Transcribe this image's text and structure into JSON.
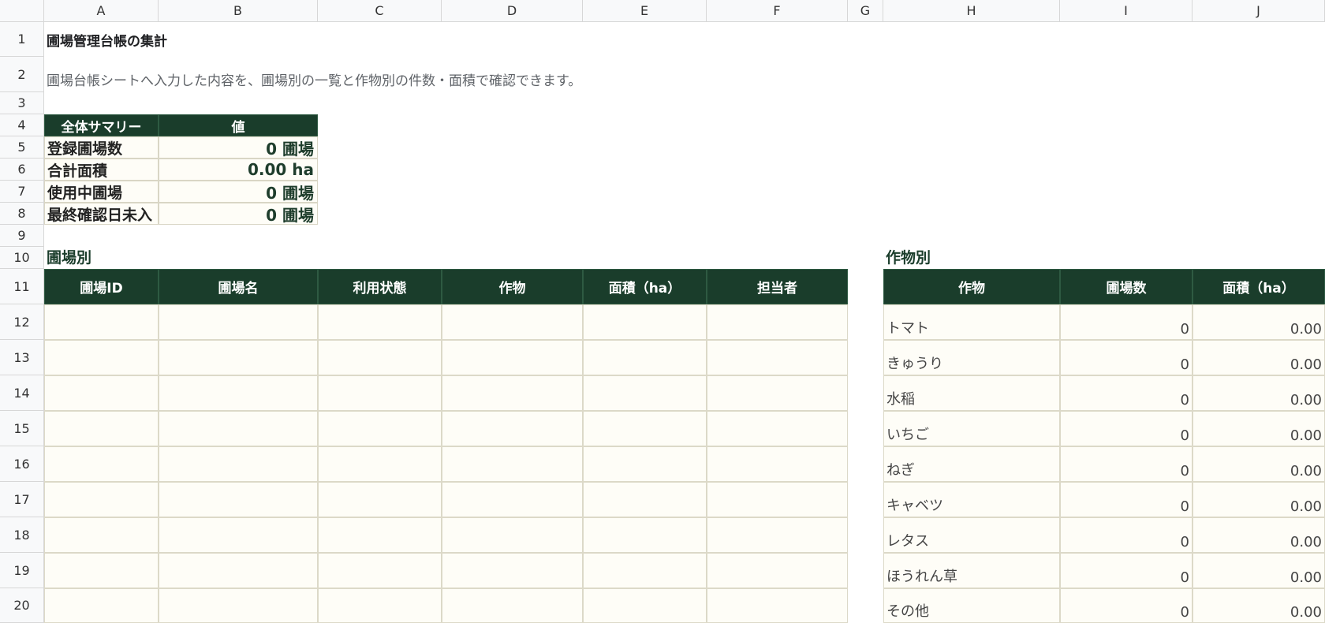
{
  "columns": [
    "A",
    "B",
    "C",
    "D",
    "E",
    "F",
    "G",
    "H",
    "I",
    "J"
  ],
  "rows": [
    "1",
    "2",
    "3",
    "4",
    "5",
    "6",
    "7",
    "8",
    "9",
    "10",
    "11",
    "12",
    "13",
    "14",
    "15",
    "16",
    "17",
    "18",
    "19",
    "20"
  ],
  "title": "圃場管理台帳の集計",
  "subtitle": "圃場台帳シートへ入力した内容を、圃場別の一覧と作物別の件数・面積で確認できます。",
  "summary": {
    "header_label": "全体サマリー",
    "header_value": "値",
    "items": [
      {
        "label": "登録圃場数",
        "value": "0 圃場"
      },
      {
        "label": "合計面積",
        "value": "0.00 ha"
      },
      {
        "label": "使用中圃場",
        "value": "0 圃場"
      },
      {
        "label": "最終確認日未入",
        "value": "0 圃場"
      }
    ]
  },
  "field_section": {
    "title": "圃場別",
    "headers": [
      "圃場ID",
      "圃場名",
      "利用状態",
      "作物",
      "面積（ha）",
      "担当者"
    ]
  },
  "crop_section": {
    "title": "作物別",
    "headers": [
      "作物",
      "圃場数",
      "面積（ha）"
    ],
    "rows": [
      {
        "crop": "トマト",
        "count": "0",
        "area": "0.00"
      },
      {
        "crop": "きゅうり",
        "count": "0",
        "area": "0.00"
      },
      {
        "crop": "水稲",
        "count": "0",
        "area": "0.00"
      },
      {
        "crop": "いちご",
        "count": "0",
        "area": "0.00"
      },
      {
        "crop": "ねぎ",
        "count": "0",
        "area": "0.00"
      },
      {
        "crop": "キャベツ",
        "count": "0",
        "area": "0.00"
      },
      {
        "crop": "レタス",
        "count": "0",
        "area": "0.00"
      },
      {
        "crop": "ほうれん草",
        "count": "0",
        "area": "0.00"
      },
      {
        "crop": "その他",
        "count": "0",
        "area": "0.00"
      }
    ]
  }
}
